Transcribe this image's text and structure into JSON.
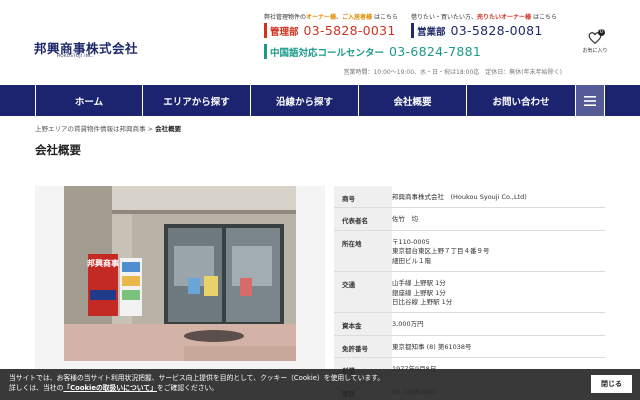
{
  "header": {
    "logo": "邦興商事株式会社",
    "logo_sub": "HOKOSYOJI INC.",
    "note_left_pre": "弊社管理物件の",
    "note_left_owner": "オーナー様",
    "note_left_mid": "、",
    "note_left_tenant": "ご入居者様",
    "note_left_post": " はこちら",
    "note_right_pre": "借りたい・買いたい",
    "note_right_mid": "方、",
    "note_right_owner": "売りたいオーナー様",
    "note_right_post": " はこちら",
    "phones": {
      "kanri_label": "管理部",
      "kanri_number": "03-5828-0031",
      "eigyo_label": "営業部",
      "eigyo_number": "03-5828-0081",
      "cn_label": "中国語対応コールセンター",
      "cn_number": "03-6824-7881"
    },
    "hours": "営業時間：10:00～19:00、水・日・祝は18:00迄　定休日：無休(年末年始除く)",
    "favorites_label": "お気に入り",
    "favorites_count": "0"
  },
  "nav": {
    "items": [
      "ホーム",
      "エリアから探す",
      "沿線から探す",
      "会社概要",
      "お問い合わせ"
    ],
    "menu_icon": "hamburger-icon"
  },
  "breadcrumb": {
    "home": "上野エリアの賃貸物件情報は邦興商事",
    "separator": " > ",
    "current": "会社概要"
  },
  "page_title": "会社概要",
  "photo": {
    "signage_text": "邦興商事"
  },
  "company_info": {
    "rows": [
      {
        "key": "商号",
        "lines": [
          "邦興商事株式会社　(Houkou Syouji Co.,Ltd)"
        ]
      },
      {
        "key": "代表者名",
        "lines": [
          "佐竹　均"
        ]
      },
      {
        "key": "所在地",
        "lines": [
          "〒110-0005",
          "東京都台東区上野７丁目４番９号",
          "細田ビル１階"
        ]
      },
      {
        "key": "交通",
        "lines": [
          "山手線 上野駅 1分",
          "銀座線 上野駅 1分",
          "日比谷線 上野駅 1分"
        ]
      },
      {
        "key": "資本金",
        "lines": [
          "3,000万円"
        ]
      },
      {
        "key": "免許番号",
        "lines": [
          "東京都知事 (8) 第61038号"
        ]
      },
      {
        "key": "創業",
        "lines": [
          "1977年9月8日"
        ]
      },
      {
        "key": "電話",
        "lines": [
          "03-5828-0081"
        ]
      }
    ]
  },
  "cookie": {
    "line1": "当サイトでは、お客様の当サイト利用状況把握、サービス向上提供を目的として、クッキー（Cookie）を使用しています。",
    "line2_pre": "詳しくは、当社の",
    "line2_link": "「Cookieの取扱いについて」",
    "line2_post": "をご確認ください。",
    "close_label": "閉じる"
  },
  "colors": {
    "nav_bg": "#1c2470",
    "accent_red": "#d0321e",
    "accent_navy": "#1f2a6b",
    "accent_teal": "#1a9a8a",
    "accent_orange": "#e08a00"
  }
}
